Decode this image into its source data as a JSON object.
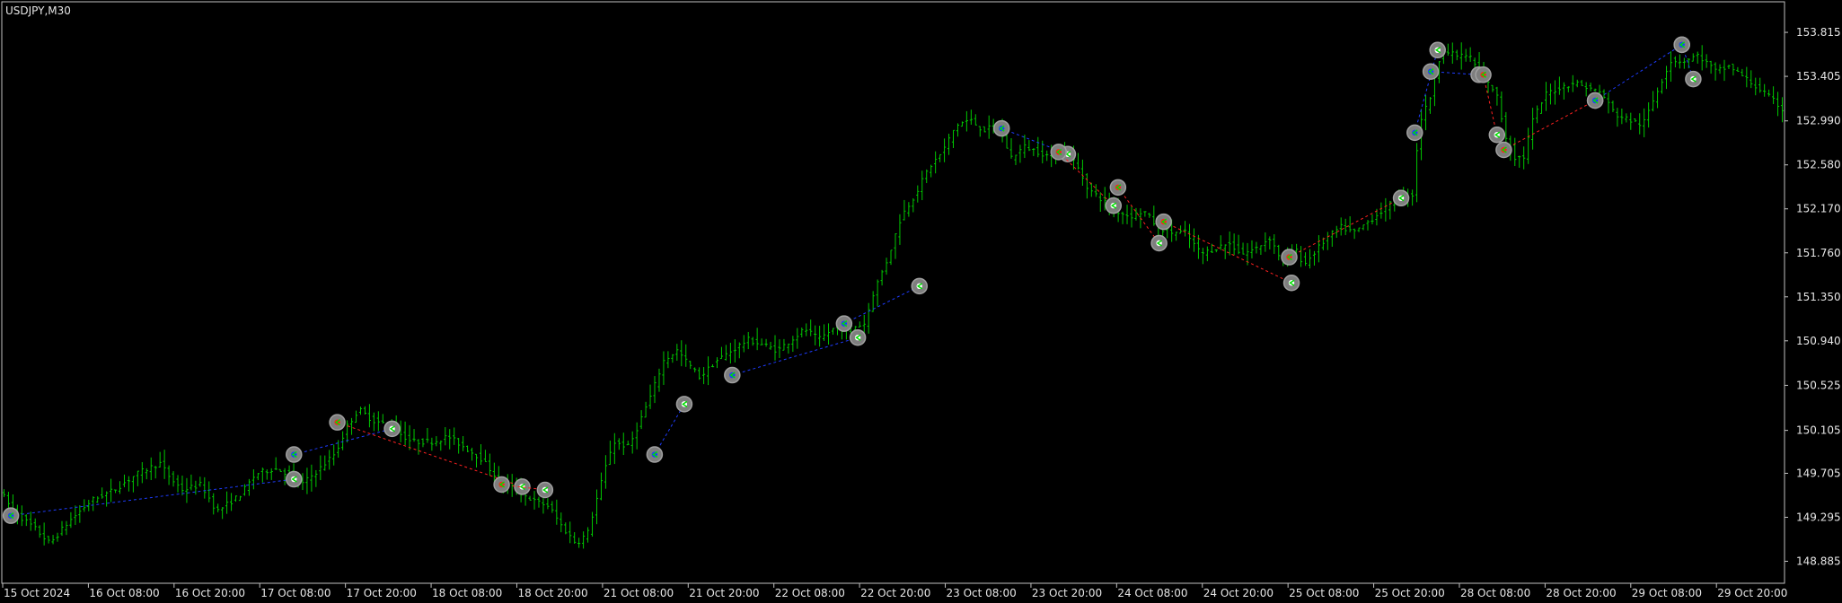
{
  "symbol_label": "USDJPY,M30",
  "colors": {
    "background": "#000000",
    "bars": "#00c800",
    "frame": "#c0c0c0",
    "text": "#e6e6e6",
    "buy_line": "#1e3cff",
    "sell_line": "#ff2020",
    "marker_ring": "#a0a0a0"
  },
  "chart_data": {
    "type": "bar",
    "symbol": "USDJPY",
    "timeframe": "M30",
    "ylim": [
      148.68,
      154.1
    ],
    "y_ticks": [
      "153.815",
      "153.405",
      "152.990",
      "152.580",
      "152.170",
      "151.760",
      "151.350",
      "150.940",
      "150.525",
      "150.105",
      "149.705",
      "149.295",
      "148.885"
    ],
    "y_tick_values": [
      153.815,
      153.405,
      152.99,
      152.58,
      152.17,
      151.76,
      151.35,
      150.94,
      150.525,
      150.105,
      149.705,
      149.295,
      148.885
    ],
    "x_ticks": [
      "15 Oct 2024",
      "16 Oct 08:00",
      "16 Oct 20:00",
      "17 Oct 08:00",
      "17 Oct 20:00",
      "18 Oct 08:00",
      "18 Oct 20:00",
      "21 Oct 08:00",
      "21 Oct 20:00",
      "22 Oct 08:00",
      "22 Oct 20:00",
      "23 Oct 08:00",
      "23 Oct 20:00",
      "24 Oct 08:00",
      "24 Oct 20:00",
      "25 Oct 08:00",
      "25 Oct 20:00",
      "28 Oct 08:00",
      "28 Oct 20:00",
      "29 Oct 08:00",
      "29 Oct 20:00"
    ],
    "bar_count": 400,
    "price_path": [
      [
        0,
        149.55
      ],
      [
        6,
        149.35
      ],
      [
        15,
        149.2
      ],
      [
        22,
        149.05
      ],
      [
        30,
        149.25
      ],
      [
        40,
        149.45
      ],
      [
        50,
        149.55
      ],
      [
        60,
        149.7
      ],
      [
        70,
        149.8
      ],
      [
        75,
        149.65
      ],
      [
        80,
        149.55
      ],
      [
        88,
        149.6
      ],
      [
        95,
        149.35
      ],
      [
        105,
        149.5
      ],
      [
        112,
        149.7
      ],
      [
        120,
        149.75
      ],
      [
        127,
        149.7
      ],
      [
        132,
        149.6
      ],
      [
        140,
        149.75
      ],
      [
        147,
        149.9
      ],
      [
        152,
        150.15
      ],
      [
        157,
        150.3
      ],
      [
        163,
        150.2
      ],
      [
        170,
        150.15
      ],
      [
        180,
        150.0
      ],
      [
        190,
        150.0
      ],
      [
        196,
        150.05
      ],
      [
        203,
        149.95
      ],
      [
        210,
        149.85
      ],
      [
        218,
        149.65
      ],
      [
        226,
        149.55
      ],
      [
        233,
        149.45
      ],
      [
        240,
        149.4
      ],
      [
        246,
        149.2
      ],
      [
        252,
        149.05
      ],
      [
        257,
        149.15
      ],
      [
        262,
        149.55
      ],
      [
        268,
        150.0
      ],
      [
        275,
        149.95
      ],
      [
        280,
        150.2
      ],
      [
        285,
        150.45
      ],
      [
        290,
        150.75
      ],
      [
        296,
        150.85
      ],
      [
        300,
        150.75
      ],
      [
        306,
        150.6
      ],
      [
        313,
        150.75
      ],
      [
        320,
        150.85
      ],
      [
        327,
        150.95
      ],
      [
        334,
        150.9
      ],
      [
        340,
        150.85
      ],
      [
        346,
        150.95
      ],
      [
        352,
        151.05
      ],
      [
        358,
        150.95
      ],
      [
        364,
        151.05
      ],
      [
        370,
        151.05
      ],
      [
        378,
        151.1
      ],
      [
        382,
        151.4
      ],
      [
        388,
        151.7
      ],
      [
        394,
        152.1
      ],
      [
        400,
        152.3
      ],
      [
        406,
        152.55
      ],
      [
        412,
        152.7
      ],
      [
        418,
        152.95
      ],
      [
        424,
        153.0
      ],
      [
        430,
        152.9
      ],
      [
        436,
        152.95
      ],
      [
        442,
        152.65
      ],
      [
        448,
        152.75
      ],
      [
        454,
        152.7
      ],
      [
        460,
        152.65
      ],
      [
        466,
        152.7
      ],
      [
        470,
        152.6
      ],
      [
        476,
        152.35
      ],
      [
        482,
        152.25
      ],
      [
        488,
        152.15
      ],
      [
        494,
        152.1
      ],
      [
        500,
        152.15
      ],
      [
        506,
        152.0
      ],
      [
        512,
        151.95
      ],
      [
        518,
        151.95
      ],
      [
        525,
        151.75
      ],
      [
        531,
        151.8
      ],
      [
        537,
        151.85
      ],
      [
        543,
        151.75
      ],
      [
        549,
        151.8
      ],
      [
        555,
        151.9
      ],
      [
        560,
        151.7
      ],
      [
        566,
        151.8
      ],
      [
        570,
        151.65
      ],
      [
        574,
        151.75
      ],
      [
        580,
        151.9
      ],
      [
        586,
        152.0
      ],
      [
        592,
        151.95
      ],
      [
        598,
        152.05
      ],
      [
        604,
        152.15
      ],
      [
        610,
        152.25
      ],
      [
        615,
        152.3
      ],
      [
        618,
        152.3
      ],
      [
        620,
        152.95
      ],
      [
        625,
        153.2
      ],
      [
        630,
        153.65
      ],
      [
        636,
        153.6
      ],
      [
        642,
        153.6
      ],
      [
        648,
        153.4
      ],
      [
        654,
        153.25
      ],
      [
        658,
        152.85
      ],
      [
        662,
        152.65
      ],
      [
        666,
        152.65
      ],
      [
        670,
        153.0
      ],
      [
        676,
        153.25
      ],
      [
        682,
        153.3
      ],
      [
        688,
        153.35
      ],
      [
        694,
        153.3
      ],
      [
        700,
        153.25
      ],
      [
        706,
        153.05
      ],
      [
        712,
        153.0
      ],
      [
        718,
        152.95
      ],
      [
        724,
        153.25
      ],
      [
        730,
        153.55
      ],
      [
        736,
        153.55
      ],
      [
        742,
        153.6
      ],
      [
        745,
        153.55
      ],
      [
        750,
        153.45
      ],
      [
        756,
        153.5
      ],
      [
        762,
        153.4
      ],
      [
        768,
        153.3
      ],
      [
        774,
        153.2
      ],
      [
        779,
        153.1
      ]
    ],
    "trades": [
      {
        "side": "buy",
        "open_bar": 3,
        "open": 149.31,
        "close_bar": 127,
        "close": 149.65
      },
      {
        "side": "buy",
        "open_bar": 127,
        "open": 149.88,
        "close_bar": 170,
        "close": 150.12
      },
      {
        "side": "sell",
        "open_bar": 146,
        "open": 150.18,
        "close_bar": 227,
        "close": 149.58
      },
      {
        "side": "sell",
        "open_bar": 218,
        "open": 149.6,
        "close_bar": 237,
        "close": 149.55
      },
      {
        "side": "buy",
        "open_bar": 285,
        "open": 149.88,
        "close_bar": 298,
        "close": 150.35
      },
      {
        "side": "buy",
        "open_bar": 319,
        "open": 150.62,
        "close_bar": 374,
        "close": 150.97
      },
      {
        "side": "buy",
        "open_bar": 368,
        "open": 151.1,
        "close_bar": 401,
        "close": 151.45
      },
      {
        "side": "buy",
        "open_bar": 437,
        "open": 152.92,
        "close_bar": 466,
        "close": 152.68
      },
      {
        "side": "sell",
        "open_bar": 462,
        "open": 152.7,
        "close_bar": 486,
        "close": 152.2
      },
      {
        "side": "sell",
        "open_bar": 488,
        "open": 152.37,
        "close_bar": 506,
        "close": 151.85
      },
      {
        "side": "sell",
        "open_bar": 508,
        "open": 152.05,
        "close_bar": 564,
        "close": 151.48
      },
      {
        "side": "sell",
        "open_bar": 563,
        "open": 151.72,
        "close_bar": 612,
        "close": 152.27
      },
      {
        "side": "buy",
        "open_bar": 618,
        "open": 152.88,
        "close_bar": 628,
        "close": 153.65
      },
      {
        "side": "buy",
        "open_bar": 625,
        "open": 153.45,
        "close_bar": 646,
        "close": 153.42
      },
      {
        "side": "sell",
        "open_bar": 648,
        "open": 153.42,
        "close_bar": 654,
        "close": 152.86
      },
      {
        "side": "sell",
        "open_bar": 657,
        "open": 152.72,
        "close_bar": 697,
        "close": 153.18
      },
      {
        "side": "buy",
        "open_bar": 697,
        "open": 153.18,
        "close_bar": 735,
        "close": 153.7
      },
      {
        "side": "buy",
        "open_bar": 735,
        "open": 153.7,
        "close_bar": 740,
        "close": 153.38
      }
    ]
  }
}
